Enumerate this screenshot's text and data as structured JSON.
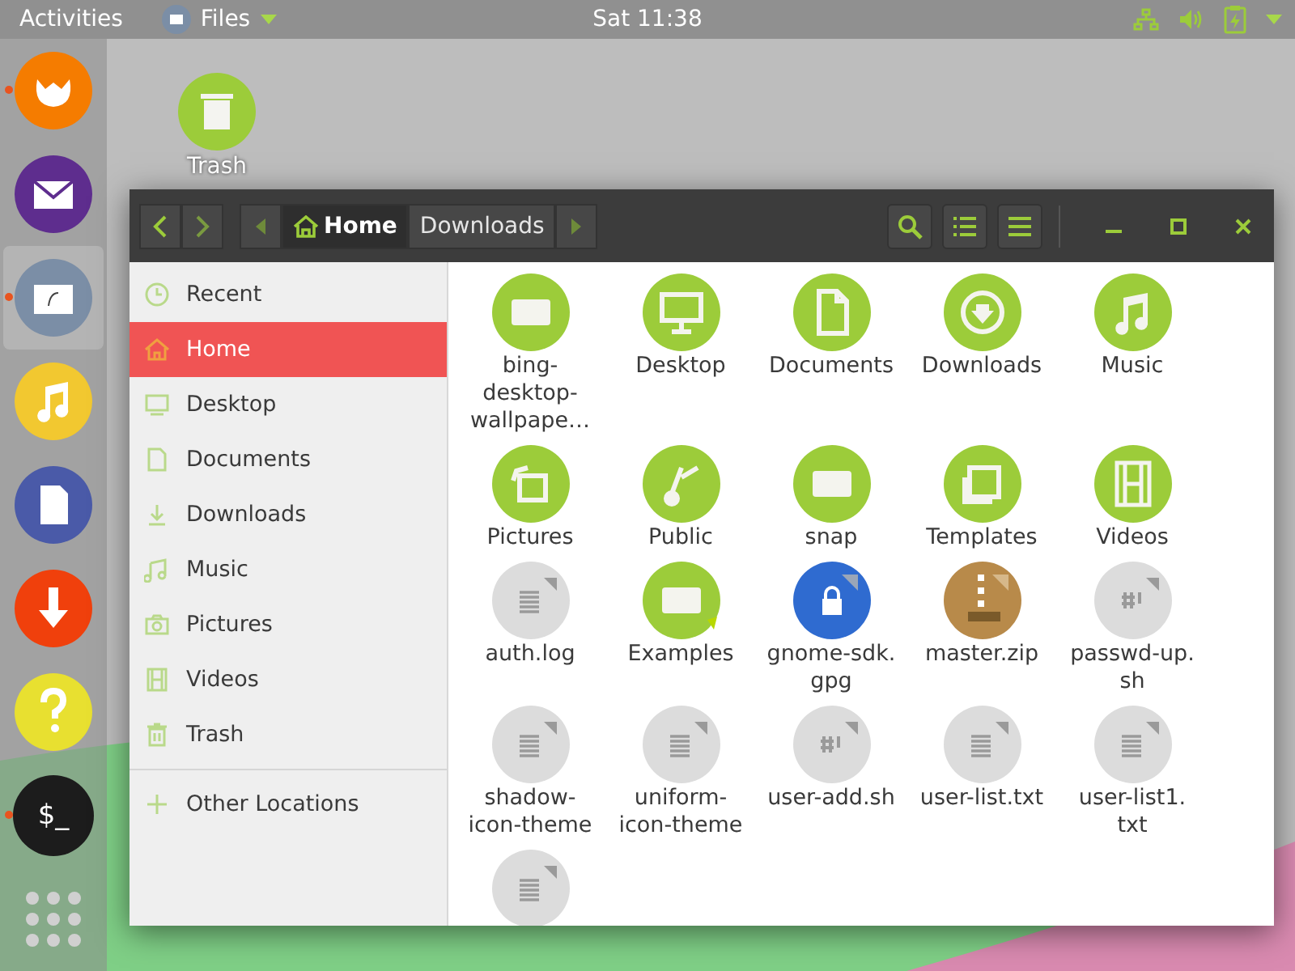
{
  "top_bar": {
    "activities": "Activities",
    "app_menu": "Files",
    "clock": "Sat 11:38"
  },
  "dock": [
    {
      "kind": "browser",
      "color": "#f57c00",
      "running": true,
      "selected": false
    },
    {
      "kind": "mail",
      "color": "#5e2d8e",
      "running": false,
      "selected": false
    },
    {
      "kind": "files",
      "color": "#7b8ea6",
      "running": true,
      "selected": true
    },
    {
      "kind": "music",
      "color": "#f2c830",
      "running": false,
      "selected": false
    },
    {
      "kind": "office",
      "color": "#4a5aa8",
      "running": false,
      "selected": false
    },
    {
      "kind": "download",
      "color": "#f0400c",
      "running": false,
      "selected": false
    },
    {
      "kind": "help",
      "color": "#e8e030",
      "running": false,
      "selected": false
    },
    {
      "kind": "terminal",
      "color": "#1c1c1c",
      "running": true,
      "selected": false,
      "label": "$_"
    },
    {
      "kind": "apps",
      "color": "#d0d0d0",
      "running": false,
      "selected": false
    }
  ],
  "desktop_icons": [
    {
      "name": "Trash"
    }
  ],
  "window": {
    "path": [
      {
        "label": "Home",
        "selected": true
      },
      {
        "label": "Downloads",
        "selected": false
      }
    ],
    "sidebar": [
      {
        "kind": "recent",
        "label": "Recent",
        "selected": false
      },
      {
        "kind": "home",
        "label": "Home",
        "selected": true
      },
      {
        "kind": "desktop",
        "label": "Desktop",
        "selected": false
      },
      {
        "kind": "documents",
        "label": "Documents",
        "selected": false
      },
      {
        "kind": "downloads",
        "label": "Downloads",
        "selected": false
      },
      {
        "kind": "music",
        "label": "Music",
        "selected": false
      },
      {
        "kind": "pictures",
        "label": "Pictures",
        "selected": false
      },
      {
        "kind": "videos",
        "label": "Videos",
        "selected": false
      },
      {
        "kind": "trash",
        "label": "Trash",
        "selected": false
      },
      {
        "kind": "other",
        "label": "Other Locations",
        "selected": false
      }
    ],
    "files": [
      {
        "kind": "folder",
        "name": "bing-\ndesktop-\nwallpape…"
      },
      {
        "kind": "desktop",
        "name": "Desktop"
      },
      {
        "kind": "documents",
        "name": "Documents"
      },
      {
        "kind": "downloads",
        "name": "Downloads"
      },
      {
        "kind": "music",
        "name": "Music"
      },
      {
        "kind": "pictures",
        "name": "Pictures"
      },
      {
        "kind": "public",
        "name": "Public"
      },
      {
        "kind": "folder",
        "name": "snap"
      },
      {
        "kind": "templates",
        "name": "Templates"
      },
      {
        "kind": "videos",
        "name": "Videos"
      },
      {
        "kind": "text",
        "name": "auth.log"
      },
      {
        "kind": "link",
        "name": "Examples"
      },
      {
        "kind": "key",
        "name": "gnome-sdk.\ngpg"
      },
      {
        "kind": "zip",
        "name": "master.zip"
      },
      {
        "kind": "script",
        "name": "passwd-up.\nsh"
      },
      {
        "kind": "text",
        "name": "shadow-\nicon-theme"
      },
      {
        "kind": "text",
        "name": "uniform-\nicon-theme"
      },
      {
        "kind": "script",
        "name": "user-add.sh"
      },
      {
        "kind": "text",
        "name": "user-list.txt"
      },
      {
        "kind": "text",
        "name": "user-list1.\ntxt"
      },
      {
        "kind": "text"
      }
    ]
  }
}
